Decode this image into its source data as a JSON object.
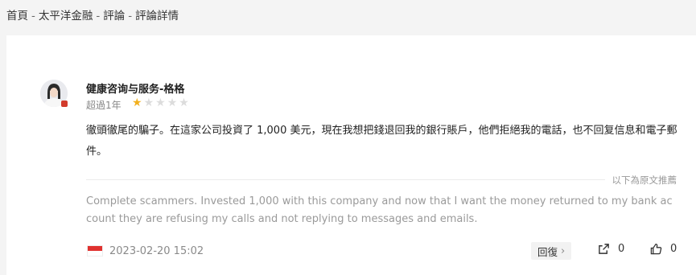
{
  "breadcrumb": {
    "items": [
      "首頁",
      "太平洋金融",
      "評論",
      "評論詳情"
    ],
    "separator": "-"
  },
  "review": {
    "user_name": "健康咨询与服务-格格",
    "time_ago": "超過1年",
    "rating": 1,
    "max_rating": 5,
    "text": "徹頭徹尾的騙子。在這家公司投資了 1,000 美元，現在我想把錢退回我的銀行賬戶，他們拒絕我的電話，也不回复信息和電子郵件。",
    "translate_note": "以下為原文推薦",
    "translation": "Complete scammers. Invested 1,000 with this company and now that I want the money returned to my bank account they are refusing my calls and not replying to messages and emails.",
    "date": "2023-02-20 15:02",
    "reply_label": "回復",
    "share_count": "0",
    "like_count": "0"
  },
  "colors": {
    "star_on": "#f2b01e",
    "star_off": "#dcdcdc",
    "flag_red": "#e0312f"
  },
  "icons": {
    "flag": "singapore-flag-icon",
    "share": "share-icon",
    "like": "thumbs-up-icon",
    "reply_chevron": "chevron-right-icon"
  }
}
